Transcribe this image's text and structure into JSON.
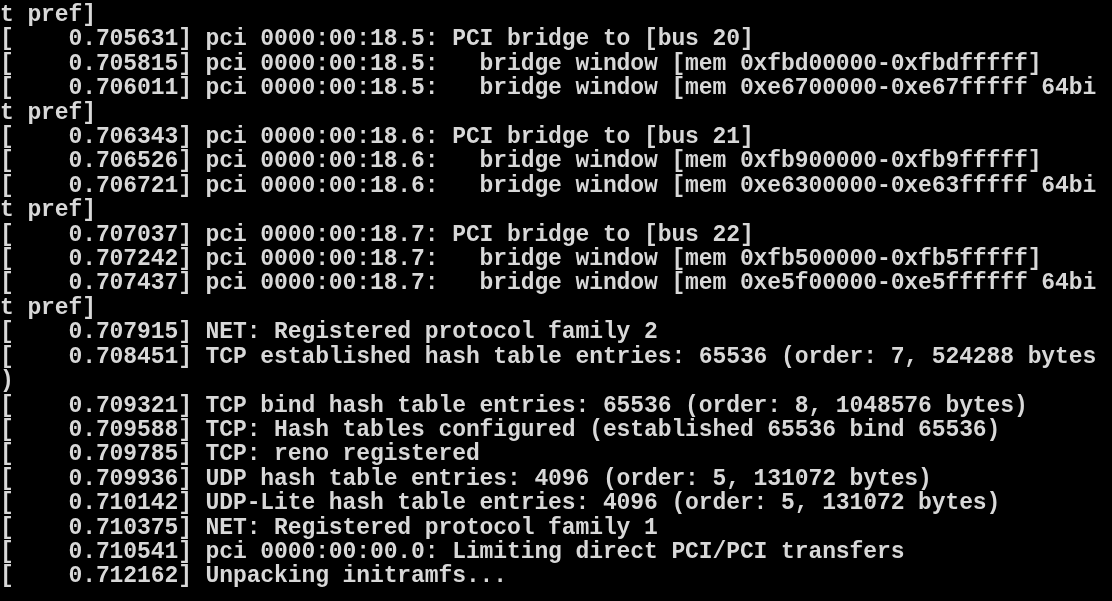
{
  "console": {
    "lines": [
      "t pref]",
      "[    0.705631] pci 0000:00:18.5: PCI bridge to [bus 20]",
      "[    0.705815] pci 0000:00:18.5:   bridge window [mem 0xfbd00000-0xfbdfffff]",
      "[    0.706011] pci 0000:00:18.5:   bridge window [mem 0xe6700000-0xe67fffff 64bi",
      "t pref]",
      "[    0.706343] pci 0000:00:18.6: PCI bridge to [bus 21]",
      "[    0.706526] pci 0000:00:18.6:   bridge window [mem 0xfb900000-0xfb9fffff]",
      "[    0.706721] pci 0000:00:18.6:   bridge window [mem 0xe6300000-0xe63fffff 64bi",
      "t pref]",
      "[    0.707037] pci 0000:00:18.7: PCI bridge to [bus 22]",
      "[    0.707242] pci 0000:00:18.7:   bridge window [mem 0xfb500000-0xfb5fffff]",
      "[    0.707437] pci 0000:00:18.7:   bridge window [mem 0xe5f00000-0xe5ffffff 64bi",
      "t pref]",
      "[    0.707915] NET: Registered protocol family 2",
      "[    0.708451] TCP established hash table entries: 65536 (order: 7, 524288 bytes",
      ")",
      "[    0.709321] TCP bind hash table entries: 65536 (order: 8, 1048576 bytes)",
      "[    0.709588] TCP: Hash tables configured (established 65536 bind 65536)",
      "[    0.709785] TCP: reno registered",
      "[    0.709936] UDP hash table entries: 4096 (order: 5, 131072 bytes)",
      "[    0.710142] UDP-Lite hash table entries: 4096 (order: 5, 131072 bytes)",
      "[    0.710375] NET: Registered protocol family 1",
      "[    0.710541] pci 0000:00:00.0: Limiting direct PCI/PCI transfers",
      "[    0.712162] Unpacking initramfs..."
    ]
  }
}
